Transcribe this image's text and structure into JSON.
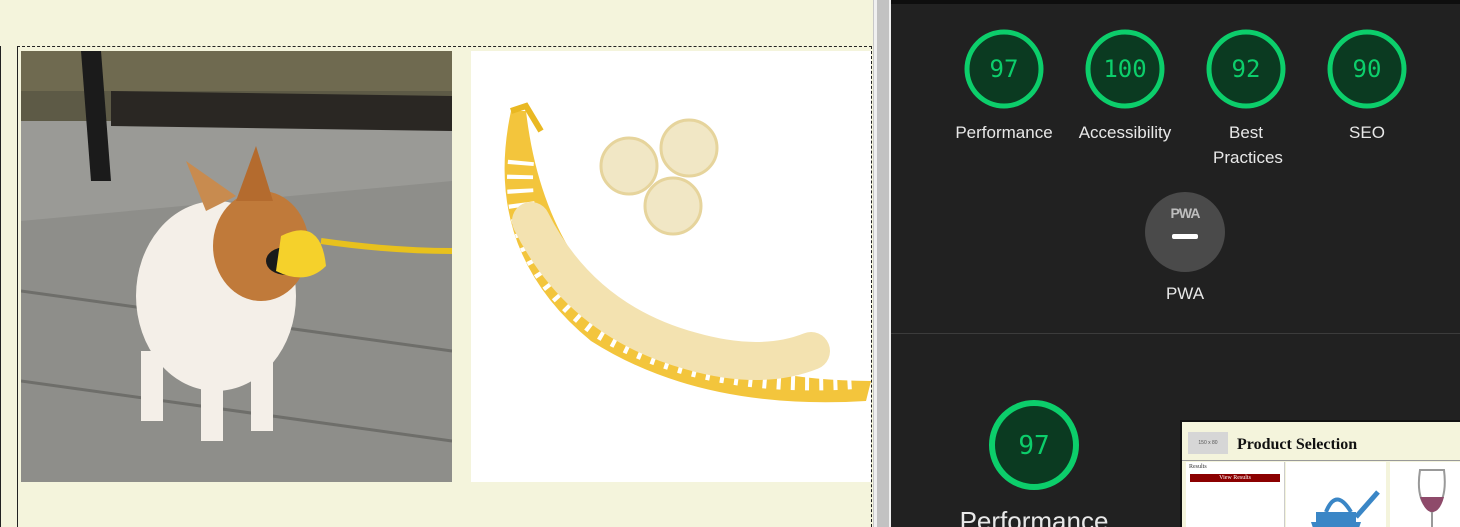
{
  "viewport": {
    "dog_image": {
      "icon": "dog-duck-muzzle-photo"
    },
    "banana_image": {
      "icon": "banana-slicer-photo"
    }
  },
  "lighthouse": {
    "categories": [
      {
        "score": "97",
        "label": "Performance"
      },
      {
        "score": "100",
        "label": "Accessibility"
      },
      {
        "score": "92",
        "label": "Best Practices"
      },
      {
        "score": "90",
        "label": "SEO"
      }
    ],
    "pwa": {
      "badge_text": "PWA",
      "label": "PWA"
    },
    "performance_section": {
      "score": "97",
      "label": "Performance"
    },
    "screenshot": {
      "logo_text": "150 x 80",
      "title": "Product Selection",
      "results_label": "Results",
      "view_results_button": "View Results"
    },
    "colors": {
      "pass": "#0cce6b",
      "pass_bg": "#0b3a21",
      "panel_bg": "#212121"
    }
  }
}
